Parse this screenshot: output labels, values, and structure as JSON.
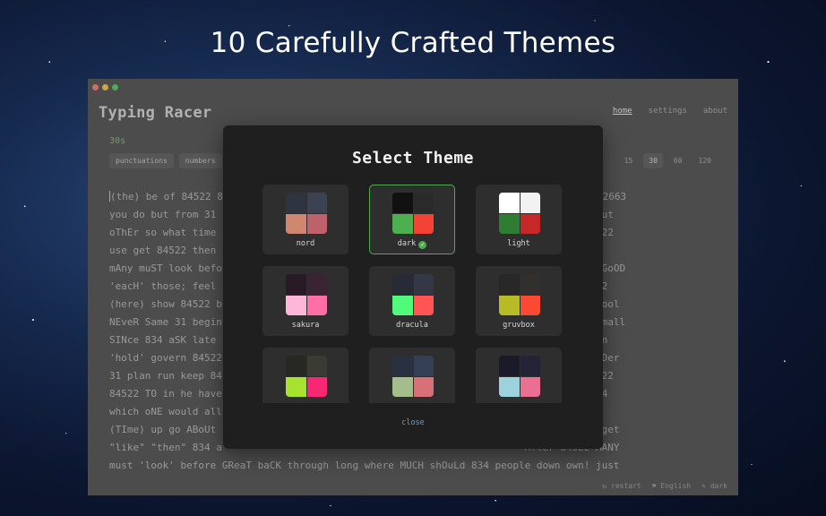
{
  "headline": "10 Carefully Crafted Themes",
  "window": {
    "traffic_lights": [
      "#ff5f57",
      "#febc2e",
      "#28c840"
    ]
  },
  "app": {
    "logo": "Typing Racer",
    "nav": [
      "home",
      "settings",
      "about"
    ],
    "timer_label": "30s",
    "toggles": [
      "punctuations",
      "numbers"
    ],
    "durations": [
      "15",
      "30",
      "60",
      "120"
    ],
    "selected_duration": "30",
    "text_lines": [
      "(the) be of 84522 8                                                   \"at\" By 2663 2663",
      "you do but from 31                                                   E) IF no man out",
      "oThEr so what time                                                   hese; know 84522",
      "use get 84522 then                                                   alsO AftEr way",
      "mAny muST look befo                                                   just beCAUsE GoOD",
      "'eacH' those; feel                                                   ll, write 84522",
      "(here) show 84522 b                                                   g general school",
      "NEveR Same 31 begin                                                   84522 84522 small",
      "SINce 834 aSK late                                                   T without again",
      "'hold' govern 84522                                                   SYSTEm set ORDer",
      "31 plan run keep 84                                                   the be Of 84522",
      "84522 TO in he have                                                   63 but 834 834",
      "which oNE would all                                                   Er 834 84522",
      "(TIme) up go ABoUt                                                   ow 84522 use? get",
      "\"like\" \"then\" 834 a                                                   AftEr 84522 MANY",
      "must 'look' before GReaT baCK through long where MUCH shOuLd 834 people down own! just"
    ],
    "footer": {
      "restart": "restart",
      "language": "English",
      "theme": "dark"
    }
  },
  "modal": {
    "title": "Select Theme",
    "close_label": "close",
    "themes": [
      {
        "name": "nord",
        "colors": [
          "#2e3440",
          "#3b4252",
          "#d08770",
          "#bf616a"
        ],
        "selected": false
      },
      {
        "name": "dark",
        "colors": [
          "#111111",
          "#2a2a2a",
          "#4caf50",
          "#f44336"
        ],
        "selected": true
      },
      {
        "name": "light",
        "colors": [
          "#ffffff",
          "#f2f2f2",
          "#2e7d32",
          "#c62828"
        ],
        "selected": false
      },
      {
        "name": "sakura",
        "colors": [
          "#2a1a26",
          "#3a2434",
          "#ffb6d9",
          "#ff6fa6"
        ],
        "selected": false
      },
      {
        "name": "dracula",
        "colors": [
          "#282a36",
          "#343746",
          "#50fa7b",
          "#ff5555"
        ],
        "selected": false
      },
      {
        "name": "gruvbox",
        "colors": [
          "#282828",
          "#32302f",
          "#b8bb26",
          "#fb4934"
        ],
        "selected": false
      },
      {
        "name": "",
        "colors": [
          "#272822",
          "#3a3b32",
          "#a6e22e",
          "#f92672"
        ],
        "selected": false
      },
      {
        "name": "",
        "colors": [
          "#293140",
          "#364055",
          "#a3be8c",
          "#d8707a"
        ],
        "selected": false
      },
      {
        "name": "",
        "colors": [
          "#1b1a2b",
          "#242338",
          "#9cd2dc",
          "#eb6f92"
        ],
        "selected": false
      }
    ]
  }
}
